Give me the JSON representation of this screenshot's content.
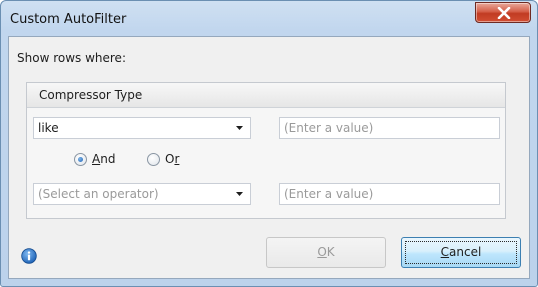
{
  "window": {
    "title": "Custom AutoFilter",
    "close_icon": "close-x-icon",
    "colors": {
      "close_button": "#c94a33",
      "frame": "#c1d6ee",
      "cancel_button": "#bee6fd"
    }
  },
  "dialog": {
    "prompt": "Show rows where:",
    "group": {
      "title": "Compressor Type",
      "condition1": {
        "operator": "like",
        "value": "",
        "value_placeholder": "(Enter a value)"
      },
      "logic": {
        "and": {
          "access_key": "A",
          "rest": "nd",
          "checked": true
        },
        "or": {
          "prefix": "O",
          "access_key": "r",
          "checked": false
        }
      },
      "condition2": {
        "operator_placeholder": "(Select an operator)",
        "value": "",
        "value_placeholder": "(Enter a value)"
      }
    }
  },
  "footer": {
    "info_icon": "info-icon",
    "ok": {
      "access_key": "O",
      "rest": "K",
      "enabled": false
    },
    "cancel": {
      "access_key": "C",
      "rest": "ancel"
    }
  }
}
